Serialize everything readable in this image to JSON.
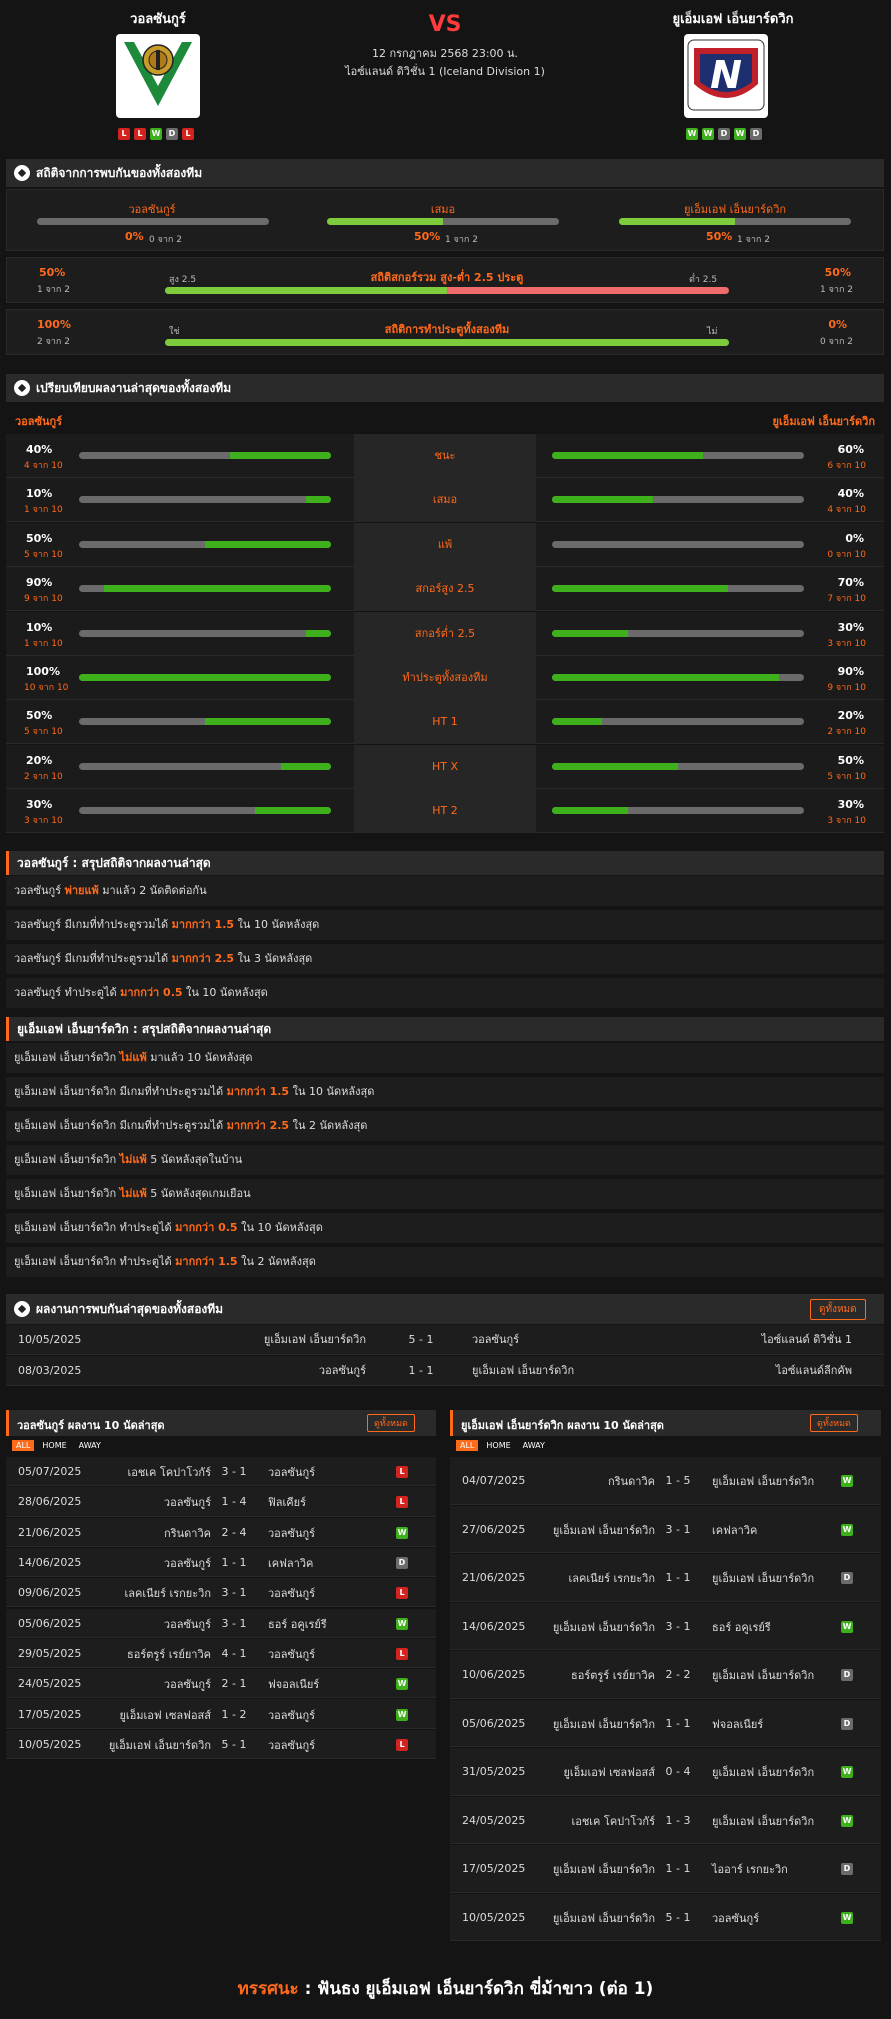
{
  "header": {
    "home_name": "วอลซันกูร์",
    "away_name": "ยูเอ็มเอฟ เอ็นยาร์ดวิก",
    "vs": "VS",
    "datetime": "12 กรกฎาคม 2568 23:00 น.",
    "league": "ไอซ์แลนด์ ดิวิชั่น 1 (Iceland Division 1)",
    "home_form": [
      "L",
      "L",
      "W",
      "D",
      "L"
    ],
    "away_form": [
      "W",
      "W",
      "D",
      "W",
      "D"
    ]
  },
  "colors": {
    "accent": "#ff6a1a",
    "win": "#3db01b",
    "loss": "#d2231f",
    "draw": "#6b6b6b",
    "bar_green": "#7dcc3b",
    "bar_red": "#f06b6b"
  },
  "h2h_stats": {
    "title": "สถิติจากการพบกันของทั้งสองทีม",
    "home_label": "วอลซันกูร์",
    "home_pct": "0%",
    "home_frac": "0 จาก 2",
    "home_value": 0,
    "draw_label": "เสมอ",
    "draw_pct": "50%",
    "draw_frac": "1 จาก 2",
    "draw_value": 0.5,
    "away_label": "ยูเอ็มเอฟ เอ็นยาร์ดวิก",
    "away_pct": "50%",
    "away_frac": "1 จาก 2",
    "away_value": 0.5,
    "ou_title": "สถิติสกอร์รวม สูง-ต่ำ 2.5 ประตู",
    "ou_left_pct": "50%",
    "ou_left_frac": "1 จาก 2",
    "ou_left_label": "สูง 2.5",
    "ou_right_pct": "50%",
    "ou_right_frac": "1 จาก 2",
    "ou_right_label": "ต่ำ 2.5",
    "ou_value": 0.5,
    "btts_title": "สถิติการทำประตูทั้งสองทีม",
    "btts_left_pct": "100%",
    "btts_left_frac": "2 จาก 2",
    "btts_left_label": "ใช่",
    "btts_right_pct": "0%",
    "btts_right_frac": "0 จาก 2",
    "btts_right_label": "ไม่",
    "btts_value": 1.0
  },
  "compare": {
    "title": "เปรียบเทียบผลงานล่าสุดของทั้งสองทีม",
    "home": "วอลซันกูร์",
    "away": "ยูเอ็มเอฟ เอ็นยาร์ดวิก",
    "rows": [
      {
        "label": "ชนะ",
        "hp": "40%",
        "hf": "4 จาก 10",
        "hv": 0.4,
        "ap": "60%",
        "af": "6 จาก 10",
        "av": 0.6
      },
      {
        "label": "เสมอ",
        "hp": "10%",
        "hf": "1 จาก 10",
        "hv": 0.1,
        "ap": "40%",
        "af": "4 จาก 10",
        "av": 0.4
      },
      {
        "label": "แพ้",
        "hp": "50%",
        "hf": "5 จาก 10",
        "hv": 0.5,
        "ap": "0%",
        "af": "0 จาก 10",
        "av": 0.0
      },
      {
        "label": "สกอร์สูง 2.5",
        "hp": "90%",
        "hf": "9 จาก 10",
        "hv": 0.9,
        "ap": "70%",
        "af": "7 จาก 10",
        "av": 0.7
      },
      {
        "label": "สกอร์ต่ำ 2.5",
        "hp": "10%",
        "hf": "1 จาก 10",
        "hv": 0.1,
        "ap": "30%",
        "af": "3 จาก 10",
        "av": 0.3
      },
      {
        "label": "ทำประตูทั้งสองทีม",
        "hp": "100%",
        "hf": "10 จาก 10",
        "hv": 1.0,
        "ap": "90%",
        "af": "9 จาก 10",
        "av": 0.9
      },
      {
        "label": "HT 1",
        "hp": "50%",
        "hf": "5 จาก 10",
        "hv": 0.5,
        "ap": "20%",
        "af": "2 จาก 10",
        "av": 0.2
      },
      {
        "label": "HT X",
        "hp": "20%",
        "hf": "2 จาก 10",
        "hv": 0.2,
        "ap": "50%",
        "af": "5 จาก 10",
        "av": 0.5
      },
      {
        "label": "HT 2",
        "hp": "30%",
        "hf": "3 จาก 10",
        "hv": 0.3,
        "ap": "30%",
        "af": "3 จาก 10",
        "av": 0.3
      }
    ]
  },
  "summary_home": {
    "title": "วอลซันกูร์ : สรุปสถิติจากผลงานล่าสุด",
    "rows": [
      {
        "a": "วอลซันกูร์ ",
        "h": "พ่ายแพ้",
        "b": " มาแล้ว 2 นัดติดต่อกัน"
      },
      {
        "a": "วอลซันกูร์ มีเกมที่ทำประตูรวมได้ ",
        "h": "มากกว่า 1.5",
        "b": " ใน 10 นัดหลังสุด"
      },
      {
        "a": "วอลซันกูร์ มีเกมที่ทำประตูรวมได้ ",
        "h": "มากกว่า 2.5",
        "b": " ใน 3 นัดหลังสุด"
      },
      {
        "a": "วอลซันกูร์ ทำประตูได้ ",
        "h": "มากกว่า 0.5",
        "b": " ใน 10 นัดหลังสุด"
      }
    ]
  },
  "summary_away": {
    "title": "ยูเอ็มเอฟ เอ็นยาร์ดวิก : สรุปสถิติจากผลงานล่าสุด",
    "rows": [
      {
        "a": "ยูเอ็มเอฟ เอ็นยาร์ดวิก ",
        "h": "ไม่แพ้",
        "b": " มาแล้ว 10 นัดหลังสุด"
      },
      {
        "a": "ยูเอ็มเอฟ เอ็นยาร์ดวิก มีเกมที่ทำประตูรวมได้ ",
        "h": "มากกว่า 1.5",
        "b": " ใน 10 นัดหลังสุด"
      },
      {
        "a": "ยูเอ็มเอฟ เอ็นยาร์ดวิก มีเกมที่ทำประตูรวมได้ ",
        "h": "มากกว่า 2.5",
        "b": " ใน 2 นัดหลังสุด"
      },
      {
        "a": "ยูเอ็มเอฟ เอ็นยาร์ดวิก ",
        "h": "ไม่แพ้",
        "b": " 5 นัดหลังสุดในบ้าน"
      },
      {
        "a": "ยูเอ็มเอฟ เอ็นยาร์ดวิก ",
        "h": "ไม่แพ้",
        "b": " 5 นัดหลังสุดเกมเยือน"
      },
      {
        "a": "ยูเอ็มเอฟ เอ็นยาร์ดวิก ทำประตูได้ ",
        "h": "มากกว่า 0.5",
        "b": " ใน 10 นัดหลังสุด"
      },
      {
        "a": "ยูเอ็มเอฟ เอ็นยาร์ดวิก ทำประตูได้ ",
        "h": "มากกว่า 1.5",
        "b": " ใน 2 นัดหลังสุด"
      }
    ]
  },
  "h2h_matches": {
    "title": "ผลงานการพบกันล่าสุดของทั้งสองทีม",
    "view_all": "ดูทั้งหมด",
    "rows": [
      {
        "date": "10/05/2025",
        "home": "ยูเอ็มเอฟ เอ็นยาร์ดวิก",
        "score": "5 - 1",
        "away": "วอลซันกูร์",
        "league": "ไอซ์แลนด์ ดิวิชั่น 1"
      },
      {
        "date": "08/03/2025",
        "home": "วอลซันกูร์",
        "score": "1 - 1",
        "away": "ยูเอ็มเอฟ เอ็นยาร์ดวิก",
        "league": "ไอซ์แลนด์ลีกคัพ"
      }
    ]
  },
  "tabs": [
    "ALL",
    "HOME",
    "AWAY"
  ],
  "home_last10": {
    "title": "วอลซันกูร์ ผลงาน 10 นัดล่าสุด",
    "view_all": "ดูทั้งหมด",
    "rows": [
      {
        "date": "05/07/2025",
        "home": "เอชเค โคปาโวกัร์",
        "score": "3 - 1",
        "away": "วอลซันกูร์",
        "r": "L"
      },
      {
        "date": "28/06/2025",
        "home": "วอลซันกูร์",
        "score": "1 - 4",
        "away": "ฟิลเคียร์",
        "r": "L"
      },
      {
        "date": "21/06/2025",
        "home": "กรินดาวิค",
        "score": "2 - 4",
        "away": "วอลซันกูร์",
        "r": "W"
      },
      {
        "date": "14/06/2025",
        "home": "วอลซันกูร์",
        "score": "1 - 1",
        "away": "เคฟลาวิค",
        "r": "D"
      },
      {
        "date": "09/06/2025",
        "home": "เลคเนียร์ เรกยะวิก",
        "score": "3 - 1",
        "away": "วอลซันกูร์",
        "r": "L"
      },
      {
        "date": "05/06/2025",
        "home": "วอลซันกูร์",
        "score": "3 - 1",
        "away": "ธอร์ อคูเรย์รี",
        "r": "W"
      },
      {
        "date": "29/05/2025",
        "home": "ธอร์ตรูร์ เรย์ยาวิค",
        "score": "4 - 1",
        "away": "วอลซันกูร์",
        "r": "L"
      },
      {
        "date": "24/05/2025",
        "home": "วอลซันกูร์",
        "score": "2 - 1",
        "away": "ฟจอลเนียร์",
        "r": "W"
      },
      {
        "date": "17/05/2025",
        "home": "ยูเอ็มเอฟ เซลฟอสส์",
        "score": "1 - 2",
        "away": "วอลซันกูร์",
        "r": "W"
      },
      {
        "date": "10/05/2025",
        "home": "ยูเอ็มเอฟ เอ็นยาร์ดวิก",
        "score": "5 - 1",
        "away": "วอลซันกูร์",
        "r": "L"
      }
    ]
  },
  "away_last10": {
    "title": "ยูเอ็มเอฟ เอ็นยาร์ดวิก ผลงาน 10 นัดล่าสุด",
    "view_all": "ดูทั้งหมด",
    "rows": [
      {
        "date": "04/07/2025",
        "home": "กรินดาวิค",
        "score": "1 - 5",
        "away": "ยูเอ็มเอฟ เอ็นยาร์ดวิก",
        "r": "W"
      },
      {
        "date": "27/06/2025",
        "home": "ยูเอ็มเอฟ เอ็นยาร์ดวิก",
        "score": "3 - 1",
        "away": "เคฟลาวิค",
        "r": "W"
      },
      {
        "date": "21/06/2025",
        "home": "เลคเนียร์ เรกยะวิก",
        "score": "1 - 1",
        "away": "ยูเอ็มเอฟ เอ็นยาร์ดวิก",
        "r": "D"
      },
      {
        "date": "14/06/2025",
        "home": "ยูเอ็มเอฟ เอ็นยาร์ดวิก",
        "score": "3 - 1",
        "away": "ธอร์ อคูเรย์รี",
        "r": "W"
      },
      {
        "date": "10/06/2025",
        "home": "ธอร์ตรูร์ เรย์ยาวิค",
        "score": "2 - 2",
        "away": "ยูเอ็มเอฟ เอ็นยาร์ดวิก",
        "r": "D"
      },
      {
        "date": "05/06/2025",
        "home": "ยูเอ็มเอฟ เอ็นยาร์ดวิก",
        "score": "1 - 1",
        "away": "ฟจอลเนียร์",
        "r": "D"
      },
      {
        "date": "31/05/2025",
        "home": "ยูเอ็มเอฟ เซลฟอสส์",
        "score": "0 - 4",
        "away": "ยูเอ็มเอฟ เอ็นยาร์ดวิก",
        "r": "W"
      },
      {
        "date": "24/05/2025",
        "home": "เอชเค โคปาโวกัร์",
        "score": "1 - 3",
        "away": "ยูเอ็มเอฟ เอ็นยาร์ดวิก",
        "r": "W"
      },
      {
        "date": "17/05/2025",
        "home": "ยูเอ็มเอฟ เอ็นยาร์ดวิก",
        "score": "1 - 1",
        "away": "ไออาร์ เรกยะวิก",
        "r": "D"
      },
      {
        "date": "10/05/2025",
        "home": "ยูเอ็มเอฟ เอ็นยาร์ดวิก",
        "score": "5 - 1",
        "away": "วอลซันกูร์",
        "r": "W"
      }
    ]
  },
  "prediction": {
    "label": "ทรรศนะ",
    "sep": " : ",
    "text": "ฟันธง ยูเอ็มเอฟ เอ็นยาร์ดวิก ขี่ม้าขาว (ต่อ 1)"
  }
}
